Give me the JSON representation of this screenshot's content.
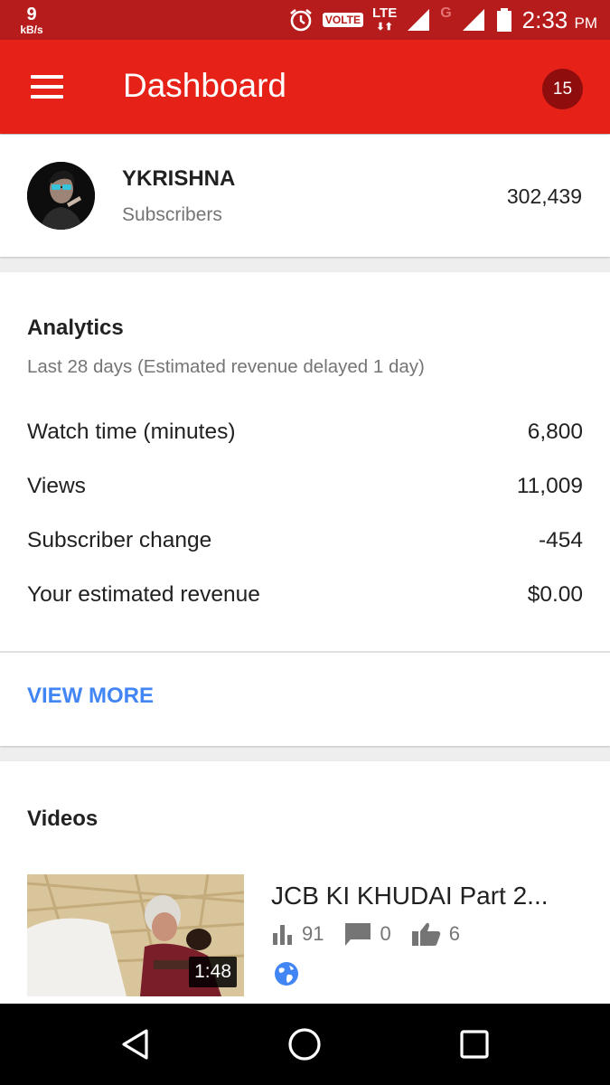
{
  "status_bar": {
    "speed_value": "9",
    "speed_unit": "kB/s",
    "volte": "VOLTE",
    "lte": "LTE",
    "g": "G",
    "time": "2:33",
    "ampm": "PM",
    "icons": [
      "alarm-icon",
      "signal-icon",
      "battery-icon"
    ]
  },
  "app_bar": {
    "title": "Dashboard",
    "notification_count": "15",
    "color": "#e62117"
  },
  "channel": {
    "name": "YKRISHNA",
    "subscribers_label": "Subscribers",
    "subscriber_count": "302,439"
  },
  "analytics": {
    "title": "Analytics",
    "subtitle": "Last 28 days (Estimated revenue delayed 1 day)",
    "metrics": [
      {
        "label": "Watch time (minutes)",
        "value": "6,800"
      },
      {
        "label": "Views",
        "value": "11,009"
      },
      {
        "label": "Subscriber change",
        "value": "-454"
      },
      {
        "label": "Your estimated revenue",
        "value": "$0.00"
      }
    ],
    "view_more": "VIEW MORE",
    "link_color": "#4285f4"
  },
  "videos": {
    "title": "Videos",
    "items": [
      {
        "title": "JCB KI KHUDAI Part 2...",
        "duration": "1:48",
        "views": "91",
        "comments": "0",
        "likes": "6",
        "visibility_icon": "globe-icon"
      }
    ]
  },
  "nav_bar": {
    "buttons": [
      "back-icon",
      "home-icon",
      "recents-icon"
    ]
  }
}
